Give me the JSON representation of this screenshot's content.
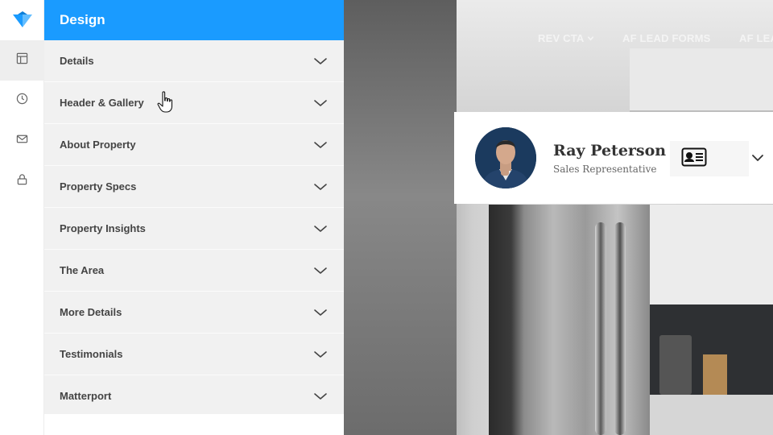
{
  "rail": {
    "items": [
      {
        "icon": "layout-icon",
        "active": true
      },
      {
        "icon": "clock-icon",
        "active": false
      },
      {
        "icon": "mail-icon",
        "active": false
      },
      {
        "icon": "lock-icon",
        "active": false
      }
    ]
  },
  "panel": {
    "title": "Design",
    "sections": [
      {
        "label": "Details"
      },
      {
        "label": "Header & Gallery"
      },
      {
        "label": "About Property"
      },
      {
        "label": "Property Specs"
      },
      {
        "label": "Property Insights"
      },
      {
        "label": "The Area"
      },
      {
        "label": "More Details"
      },
      {
        "label": "Testimonials"
      },
      {
        "label": "Matterport"
      }
    ]
  },
  "preview": {
    "nav": [
      {
        "label": "REV CTA"
      },
      {
        "label": "AF LEAD FORMS"
      },
      {
        "label": "AF LEA"
      }
    ],
    "agent": {
      "name": "Ray Peterson",
      "title": "Sales Representative",
      "contact_icon": "contact-card-icon"
    }
  },
  "colors": {
    "accent": "#1a9bff",
    "panel_bg": "#f1f1f1",
    "text_dark": "#444444"
  }
}
